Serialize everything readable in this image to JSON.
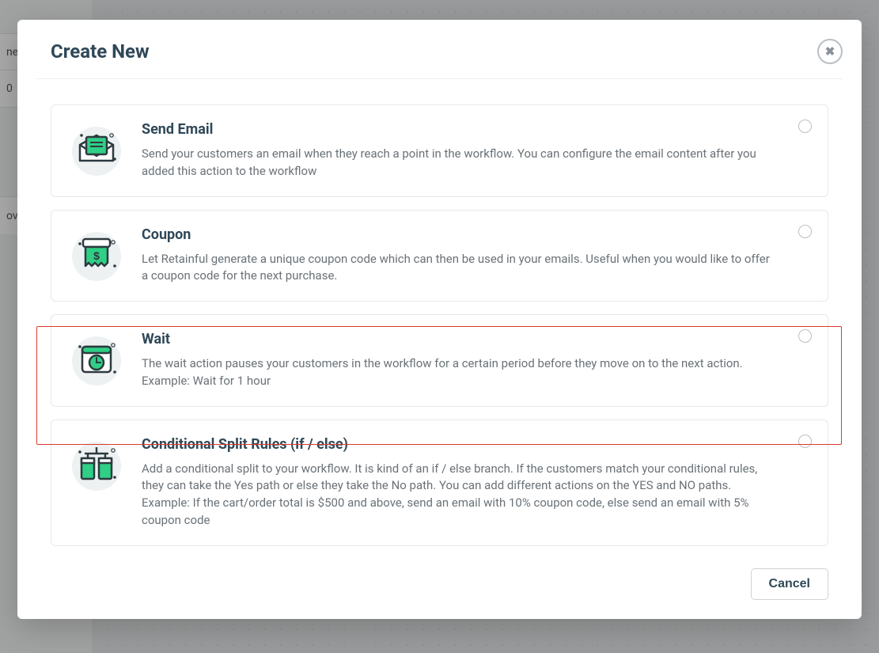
{
  "modal": {
    "title": "Create New",
    "cancel_label": "Cancel"
  },
  "bg": {
    "label_left_top": "ner",
    "label_left_mid": "0",
    "label_left_bottom": "ovin"
  },
  "options": [
    {
      "key": "send-email",
      "title": "Send Email",
      "desc": "Send your customers an email when they reach a point in the workflow. You can configure the email content after you added this action to the workflow"
    },
    {
      "key": "coupon",
      "title": "Coupon",
      "desc": "Let Retainful generate a unique coupon code which can then be used in your emails. Useful when you would like to offer a coupon code for the next purchase."
    },
    {
      "key": "wait",
      "title": "Wait",
      "desc": "The wait action pauses your customers in the workflow for a certain period before they move on to the next action. Example: Wait for 1 hour"
    },
    {
      "key": "conditional-split",
      "title": "Conditional Split Rules (if / else)",
      "desc": "Add a conditional split to your workflow. It is kind of an if / else branch. If the customers match your conditional rules, they can take the Yes path or else they take the No path. You can add different actions on the YES and NO paths. Example: If the cart/order total is $500 and above, send an email with 10% coupon code, else send an email with 5% coupon code"
    }
  ]
}
